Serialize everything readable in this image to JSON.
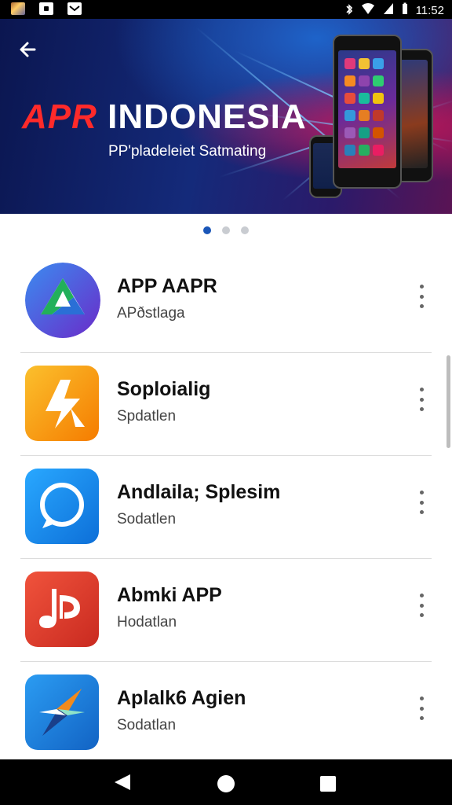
{
  "status_bar": {
    "time": "11:52",
    "icons": [
      "photo-notification-icon",
      "message-notification-icon",
      "mail-notification-icon",
      "bluetooth-icon",
      "wifi-icon",
      "signal-icon",
      "battery-icon"
    ]
  },
  "banner": {
    "brand_accent": "APR",
    "brand_rest": "INDONESIA",
    "subtitle": "PP'pladeleiet Satmating",
    "back_icon": "back-arrow-icon"
  },
  "carousel": {
    "pages": 3,
    "active": 0
  },
  "apps": [
    {
      "title": "APP AAPR",
      "subtitle": "APðstlaga",
      "icon": "triangle-play-icon",
      "color": "#2a6fd6"
    },
    {
      "title": "Soploialig",
      "subtitle": "Spdatlen",
      "icon": "star-arrow-icon",
      "color": "#f4a51c"
    },
    {
      "title": "Andlaila; Splesim",
      "subtitle": "Sodatlen",
      "icon": "chat-bubble-icon",
      "color": "#1e8fe8"
    },
    {
      "title": "Abmki  APP",
      "subtitle": "Hodatlan",
      "icon": "music-note-icon",
      "color": "#e2402f"
    },
    {
      "title": "Aplalk6 Agien",
      "subtitle": "Sodatlan",
      "icon": "compass-icon",
      "color": "#1f8ce0"
    }
  ],
  "nav": {
    "back": "nav-back-icon",
    "home": "nav-home-icon",
    "recents": "nav-recents-icon"
  },
  "colors": {
    "accent": "#1a56b8",
    "brand_red": "#ff2a2a"
  }
}
